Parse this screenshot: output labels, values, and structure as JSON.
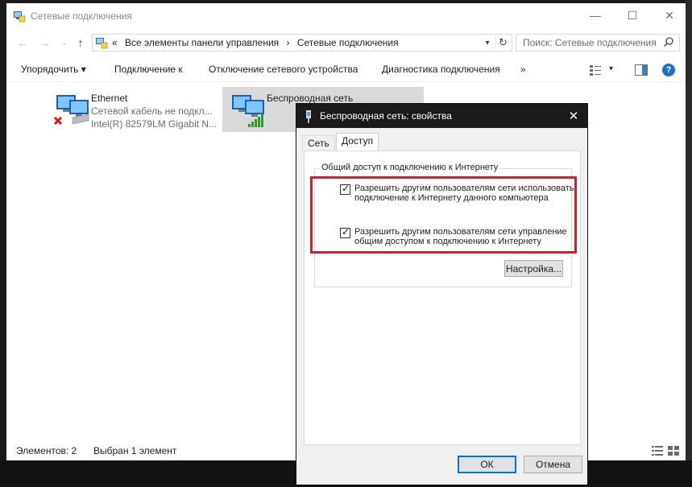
{
  "window": {
    "title": "Сетевые подключения",
    "controls": [
      "—",
      "☐",
      "✕"
    ]
  },
  "nav": {
    "breadcrumb_prefix": "«",
    "breadcrumbs": [
      "Все элементы панели управления",
      "›",
      "Сетевые подключения"
    ],
    "search_placeholder": "Поиск: Сетевые подключения"
  },
  "toolbar": {
    "organize": "Упорядочить ▾",
    "connect": "Подключение к",
    "disable": "Отключение сетевого устройства",
    "diagnose": "Диагностика подключения",
    "more": "»"
  },
  "connections": [
    {
      "name": "Ethernet",
      "status": "Сетевой кабель не подкл...",
      "device": "Intel(R) 82579LM Gigabit N..."
    },
    {
      "name": "Беспроводная сеть"
    }
  ],
  "status_bar": {
    "count": "Элементов: 2",
    "selected": "Выбран 1 элемент"
  },
  "dialog": {
    "title": "Беспроводная сеть: свойства",
    "tabs": [
      "Сеть",
      "Доступ"
    ],
    "group_title": "Общий доступ к подключению к Интернету",
    "option1": "Разрешить другим пользователям сети использовать подключение к Интернету данного компьютера",
    "option2": "Разрешить другим пользователям сети управление общим доступом к подключению к Интернету",
    "option1_checked": true,
    "option2_checked": true,
    "settings_button": "Настройка...",
    "ok_button": "ОК",
    "cancel_button": "Отмена"
  },
  "colors": {
    "highlight": "#d0202d",
    "dialog_titlebar": "#1a1a1a",
    "selection": "#d9d9d9",
    "help": "#1f6fc5"
  }
}
